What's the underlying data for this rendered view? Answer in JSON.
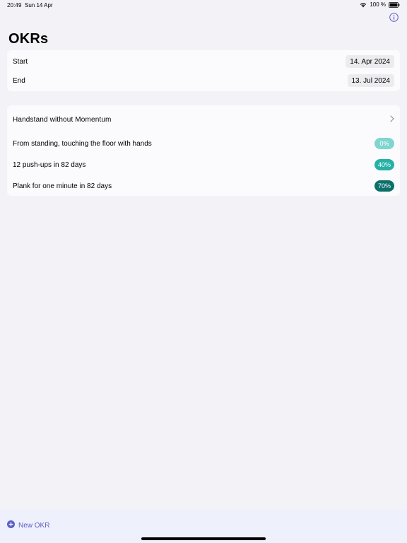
{
  "status_bar": {
    "time": "20:49",
    "date": "Sun 14 Apr",
    "battery": "100 %"
  },
  "header": {
    "title": "OKRs",
    "info_icon": "info-circle-icon"
  },
  "dates": {
    "start_label": "Start",
    "start_value": "14. Apr 2024",
    "end_label": "End",
    "end_value": "13. Jul 2024"
  },
  "objective": {
    "title": "Handstand without Momentum",
    "key_results": [
      {
        "label": "From standing, touching the floor with hands",
        "progress": "0%",
        "color": "#7fd6cf"
      },
      {
        "label": "12 push-ups in 82 days",
        "progress": "40%",
        "color": "#26b0a6"
      },
      {
        "label": "Plank for one minute in 82 days",
        "progress": "70%",
        "color": "#0d6f69"
      }
    ]
  },
  "bottom_bar": {
    "new_okr_label": "New OKR",
    "accent": "#5b5fc7"
  }
}
